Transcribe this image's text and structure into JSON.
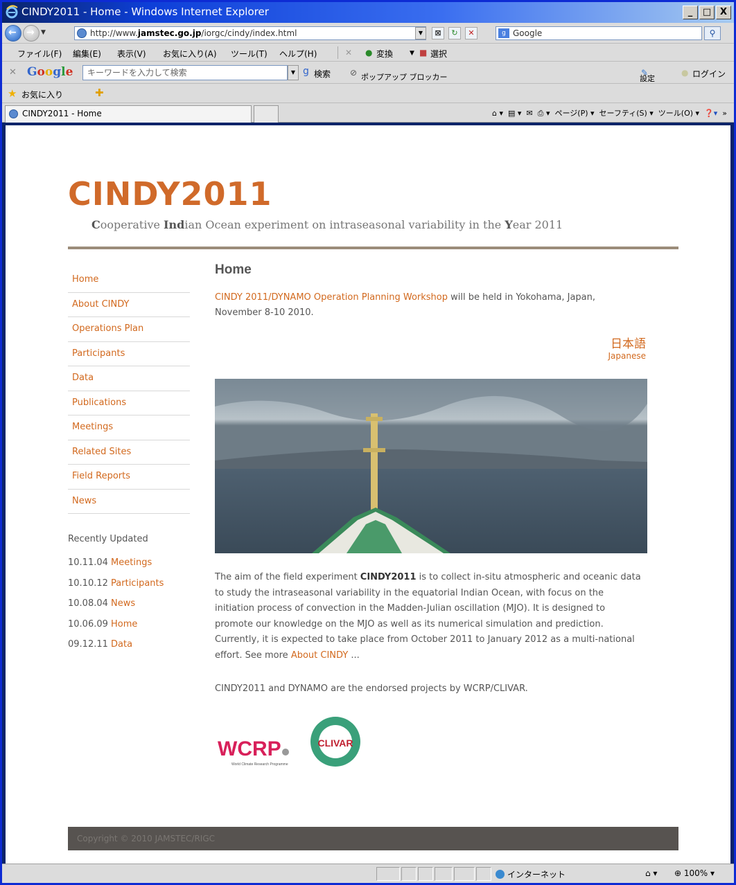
{
  "window": {
    "title": "CINDY2011 - Home - Windows Internet Explorer",
    "controls": [
      "_",
      "□",
      "X"
    ]
  },
  "address_bar": {
    "url_prefix": "http://www.",
    "url_domain": "jamstec.go.jp",
    "url_path": "/iorgc/cindy/index.html",
    "search_provider": "Google"
  },
  "menu": {
    "items": [
      "ファイル(F)",
      "編集(E)",
      "表示(V)",
      "お気に入り(A)",
      "ツール(T)",
      "ヘルプ(H)"
    ],
    "convert": "変換",
    "select": "選択"
  },
  "google_toolbar": {
    "logo": "Google",
    "search_placeholder": "キーワードを入力して検索",
    "search_label": "検索",
    "popup_blocker": "ポップアップ ブロッカー",
    "settings": "設定",
    "login": "ログイン"
  },
  "favorites_bar": {
    "label": "お気に入り"
  },
  "tab_bar": {
    "active_tab": "CINDY2011 - Home",
    "page_menu": "ページ(P)",
    "safety_menu": "セーフティ(S)",
    "tools_menu": "ツール(O)"
  },
  "site": {
    "title": "CINDY2011",
    "subtitle_parts": [
      "C",
      "ooperative ",
      "Ind",
      "ian Ocean experiment on intraseasonal variability in the ",
      "Y",
      "ear 2011"
    ]
  },
  "sidebar": {
    "items": [
      {
        "label": "Home"
      },
      {
        "label": "About CINDY"
      },
      {
        "label": "Operations Plan"
      },
      {
        "label": "Participants"
      },
      {
        "label": "Data"
      },
      {
        "label": "Publications"
      },
      {
        "label": "Meetings"
      },
      {
        "label": "Related Sites"
      },
      {
        "label": "Field Reports"
      },
      {
        "label": "News"
      }
    ],
    "recent_title": "Recently Updated",
    "recent": [
      {
        "date": "10.11.04",
        "label": "Meetings"
      },
      {
        "date": "10.10.12",
        "label": "Participants"
      },
      {
        "date": "10.08.04",
        "label": "News"
      },
      {
        "date": "10.06.09",
        "label": "Home"
      },
      {
        "date": "09.12.11",
        "label": "Data"
      }
    ]
  },
  "main": {
    "heading": "Home",
    "intro_link": "CINDY 2011/DYNAMO Operation Planning Workshop",
    "intro_text": " will be held in Yokohama, Japan, November 8-10 2010.",
    "japanese_link_big": "日本語",
    "japanese_link_small": "Japanese",
    "body_before": "The aim of the field experiment ",
    "body_bold": "CINDY2011",
    "body_after": " is to collect in-situ atmospheric and oceanic data to study the intraseasonal variability in the equatorial Indian Ocean, with focus on the initiation process of convection in the Madden-Julian oscillation (MJO).  It is designed to promote our knowledge on the MJO as well as its numerical simulation and prediction.  Currently, it is expected to take place from October 2011 to January 2012 as a multi-national effort.  See more ",
    "body_link": "About CINDY",
    "body_end": " ...",
    "endorse": "CINDY2011 and DYNAMO are the endorsed projects by WCRP/CLIVAR.",
    "logo_wcrp": "WCRP",
    "logo_wcrp_sub": "World Climate Research Programme",
    "logo_clivar": "CLIVAR"
  },
  "footer": {
    "text": "Copyright © 2010 JAMSTEC/RIGC"
  },
  "statusbar": {
    "zone": "インターネット",
    "zoom": "100%"
  }
}
